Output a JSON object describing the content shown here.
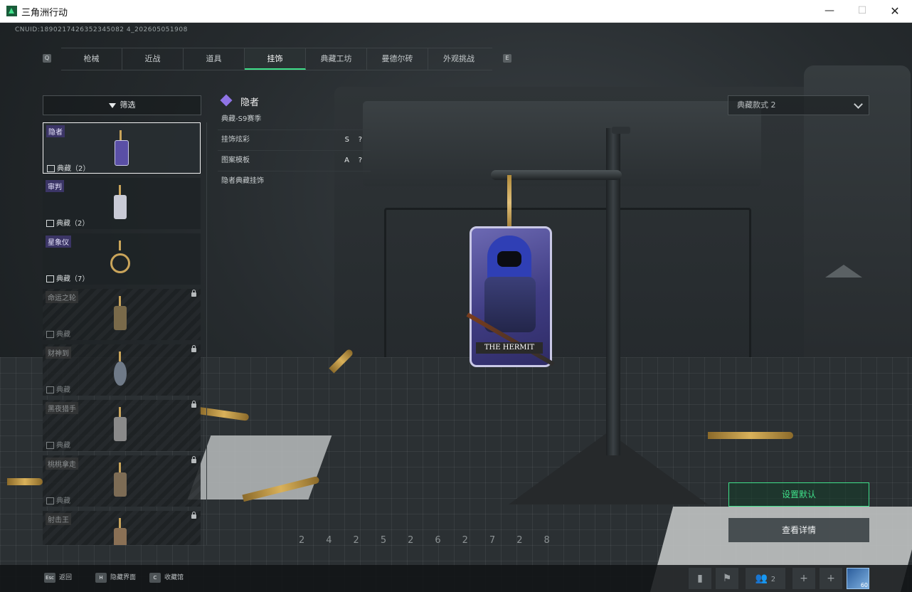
{
  "window": {
    "title": "三角洲行动",
    "minimize": "—",
    "maximize": "☐",
    "close": "✕"
  },
  "cnuid": "CNUID:1890217426352345082 4_202605051908",
  "tabs": {
    "left_key": "Q",
    "right_key": "E",
    "items": [
      "枪械",
      "近战",
      "道具",
      "挂饰",
      "典藏工坊",
      "曼德尔砖",
      "外观挑战"
    ],
    "active_index": 3
  },
  "filter": {
    "label": "筛选"
  },
  "list": [
    {
      "name": "隐者",
      "collection": "典藏（2）",
      "locked": false,
      "selected": true,
      "color": "#5a4fa6"
    },
    {
      "name": "审判",
      "collection": "典藏（2）",
      "locked": false,
      "selected": false,
      "color": "#c9cbd6"
    },
    {
      "name": "星象仪",
      "collection": "典藏（7）",
      "locked": false,
      "selected": false,
      "color": "#c9a45a"
    },
    {
      "name": "命运之轮",
      "collection": "典藏",
      "locked": true,
      "selected": false,
      "color": "#7a6a4a"
    },
    {
      "name": "财神到",
      "collection": "典藏",
      "locked": true,
      "selected": false,
      "color": "#6f7a88"
    },
    {
      "name": "黑夜猎手",
      "collection": "典藏",
      "locked": true,
      "selected": false,
      "color": "#8a8a8a"
    },
    {
      "name": "桃桃拿走",
      "collection": "典藏",
      "locked": true,
      "selected": false,
      "color": "#7d6c55"
    },
    {
      "name": "射击王",
      "collection": "",
      "locked": true,
      "selected": false,
      "color": "#8a7055"
    }
  ],
  "detail": {
    "name": "隐者",
    "season": "典藏-S9赛季",
    "rows": [
      {
        "label": "挂饰炫彩",
        "value": "S",
        "help": "?"
      },
      {
        "label": "图案模板",
        "value": "A",
        "help": "?"
      }
    ],
    "description": "隐者典藏挂饰"
  },
  "charm_card_text": "THE HERMIT",
  "style_dropdown": {
    "value": "典藏款式 2"
  },
  "actions": {
    "set_default": "设置默认",
    "view_details": "查看详情"
  },
  "mat_numbers": [
    "24",
    "25",
    "26",
    "27",
    "28"
  ],
  "bottom_hints": [
    {
      "key": "Esc",
      "label": "返回"
    },
    {
      "key": "H",
      "label": "隐藏界面"
    },
    {
      "key": "C",
      "label": "收藏馆"
    }
  ],
  "bottom_right": {
    "squad_count": "2",
    "level": "60"
  },
  "colors": {
    "accent": "#3fe08a",
    "rarity_purple": "#8f74e6"
  }
}
